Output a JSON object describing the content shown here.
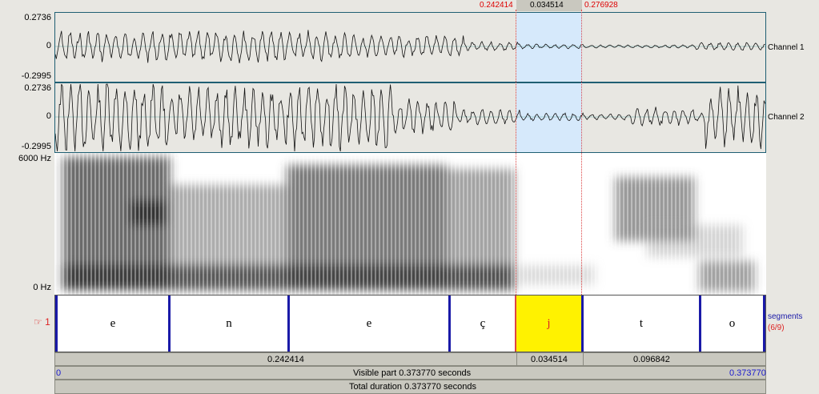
{
  "selection": {
    "start": "0.242414",
    "length": "0.034514",
    "end": "0.276928"
  },
  "waveform": {
    "channel1": {
      "label": "Channel 1",
      "max": "0.2736",
      "zero": "0",
      "min": "-0.2995"
    },
    "channel2": {
      "label": "Channel 2",
      "max": "0.2736",
      "zero": "0",
      "min": "-0.2995"
    }
  },
  "spectrogram": {
    "top": "6000 Hz",
    "bottom": "0 Hz"
  },
  "tier": {
    "marker": "☞ 1",
    "name": "segments",
    "count": "(6/9)",
    "segments": [
      "e",
      "n",
      "e",
      "ç",
      "j",
      "t",
      "o"
    ]
  },
  "durations": {
    "before": "0.242414",
    "selection": "0.034514",
    "after": "0.096842"
  },
  "visible": {
    "start": "0",
    "label": "Visible part 0.373770 seconds",
    "end": "0.373770"
  },
  "total": {
    "label": "Total duration 0.373770 seconds"
  },
  "colors": {
    "selection": "#d6e9fb",
    "highlight": "#fff200",
    "boundary": "#1a1aa8",
    "cursor": "#d44444"
  }
}
